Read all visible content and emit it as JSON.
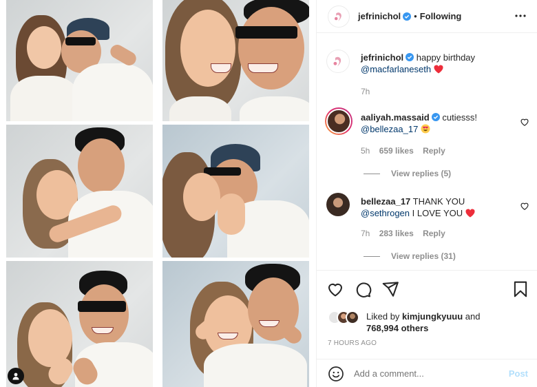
{
  "post": {
    "author": "jefrinichol",
    "follow_separator": "•",
    "follow_status": "Following",
    "more_icon": "more-horizontal-icon"
  },
  "caption": {
    "author": "jefrinichol",
    "text": "happy birthday",
    "mention": "@macfarlaneseth",
    "emoji": "red-heart",
    "time": "7h"
  },
  "comments": [
    {
      "author": "aaliyah.massaid",
      "text": "cutiesss!",
      "mention": "@bellezaa_17",
      "emoji": "heart-eyes",
      "time": "5h",
      "likes": "659 likes",
      "reply": "Reply",
      "view_replies": "View replies (5)"
    },
    {
      "author": "bellezaa_17",
      "text": "THANK YOU",
      "mention": "@sethrogen",
      "text2": "I LOVE YOU",
      "emoji": "red-heart",
      "time": "7h",
      "likes": "283 likes",
      "reply": "Reply",
      "view_replies": "View replies (31)"
    }
  ],
  "likes": {
    "prefix": "Liked by",
    "user": "kimjungkyuuu",
    "and": "and",
    "others": "768,994 others"
  },
  "timestamp": "7 HOURS AGO",
  "add_comment": {
    "placeholder": "Add a comment...",
    "post_label": "Post"
  },
  "colors": {
    "link": "#00376b",
    "muted": "#8e8e8e",
    "heart": "#ed4956",
    "verified": "#3897f0",
    "post_disabled": "#b2dffc"
  }
}
